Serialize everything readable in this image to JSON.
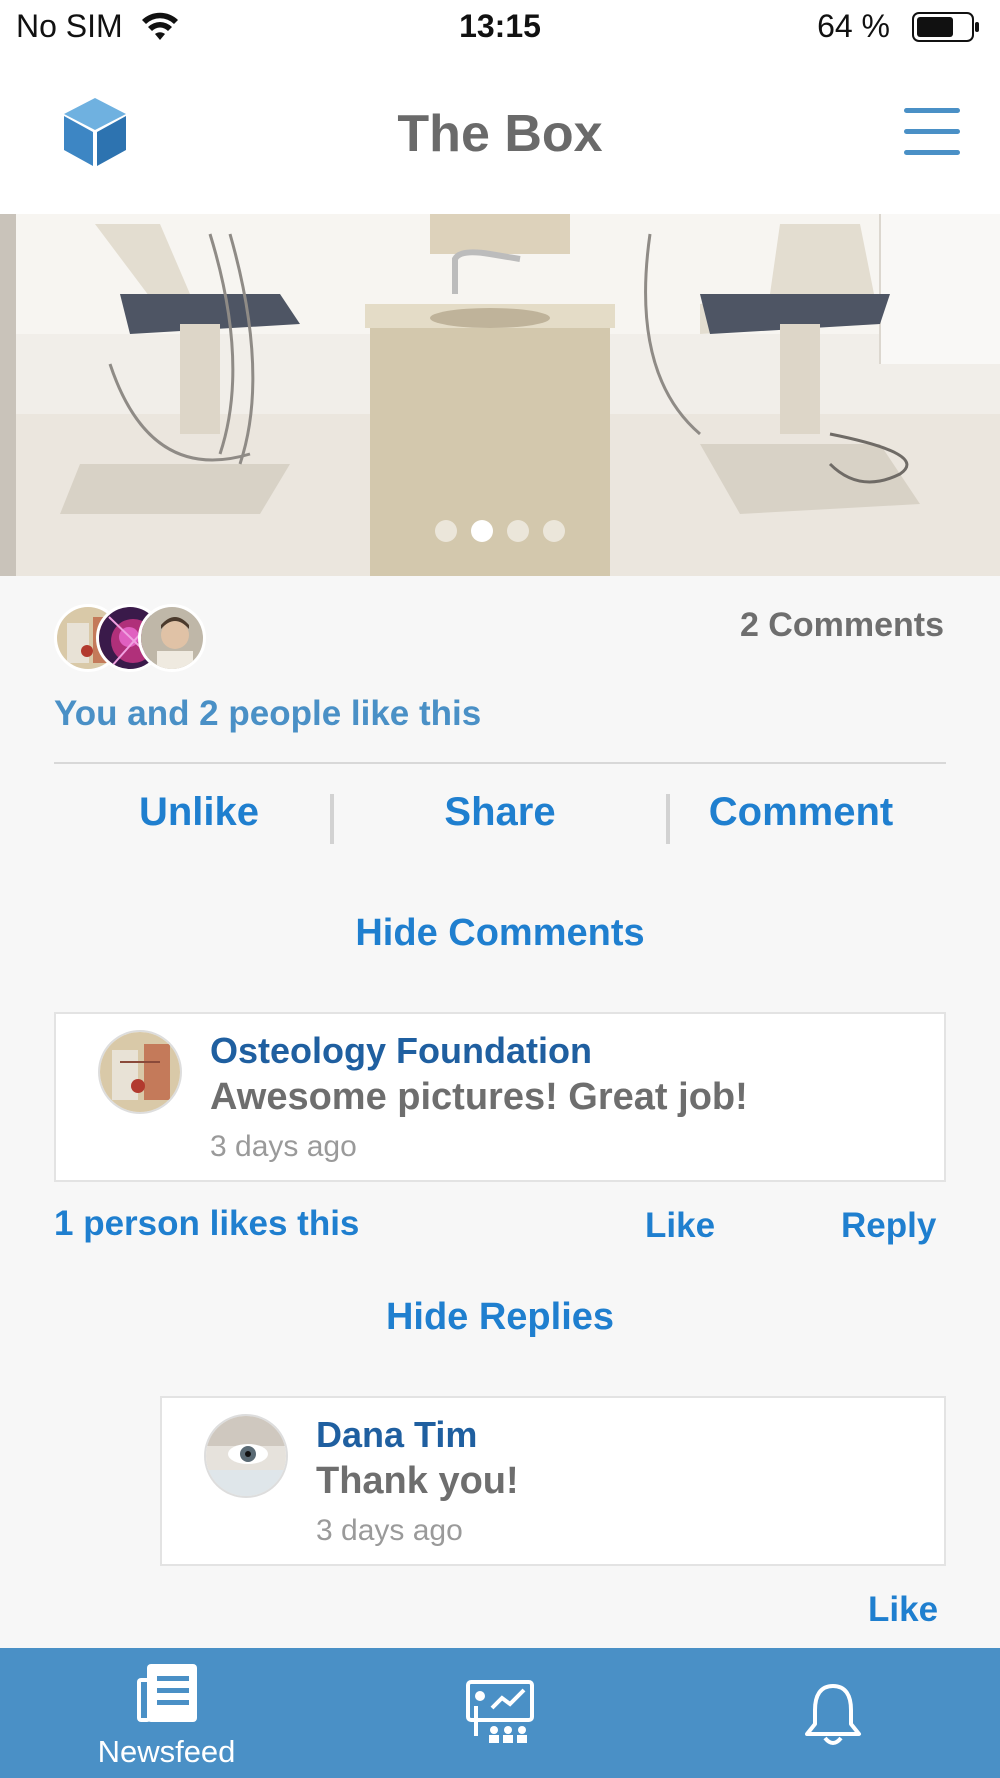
{
  "status_bar": {
    "carrier": "No SIM",
    "time": "13:15",
    "battery": "64 %",
    "wifi_icon": "wifi-icon",
    "battery_icon": "battery-icon"
  },
  "header": {
    "title": "The Box",
    "logo_icon": "cube-logo-icon",
    "menu_icon": "hamburger-menu-icon"
  },
  "carousel": {
    "slide_count": 4,
    "active_index": 1
  },
  "post": {
    "comments_count": "2 Comments",
    "likes_summary": "You and 2 people like this",
    "actions": {
      "unlike": "Unlike",
      "share": "Share",
      "comment": "Comment"
    },
    "hide_comments": "Hide Comments"
  },
  "comment": {
    "author": "Osteology Foundation",
    "text": "Awesome pictures! Great job!",
    "time": "3 days ago",
    "likes": "1 person likes this",
    "like": "Like",
    "reply": "Reply",
    "hide_replies": "Hide Replies"
  },
  "reply": {
    "author": "Dana Tim",
    "text": "Thank you!",
    "time": "3 days ago",
    "like": "Like"
  },
  "tabs": [
    {
      "label": "Newsfeed",
      "icon": "newspaper-icon"
    },
    {
      "label": "",
      "icon": "presentation-icon"
    },
    {
      "label": "",
      "icon": "bell-icon"
    }
  ],
  "colors": {
    "accent": "#1f7fcf",
    "tab_bar": "#4a90c6",
    "author": "#1f5fa0"
  }
}
